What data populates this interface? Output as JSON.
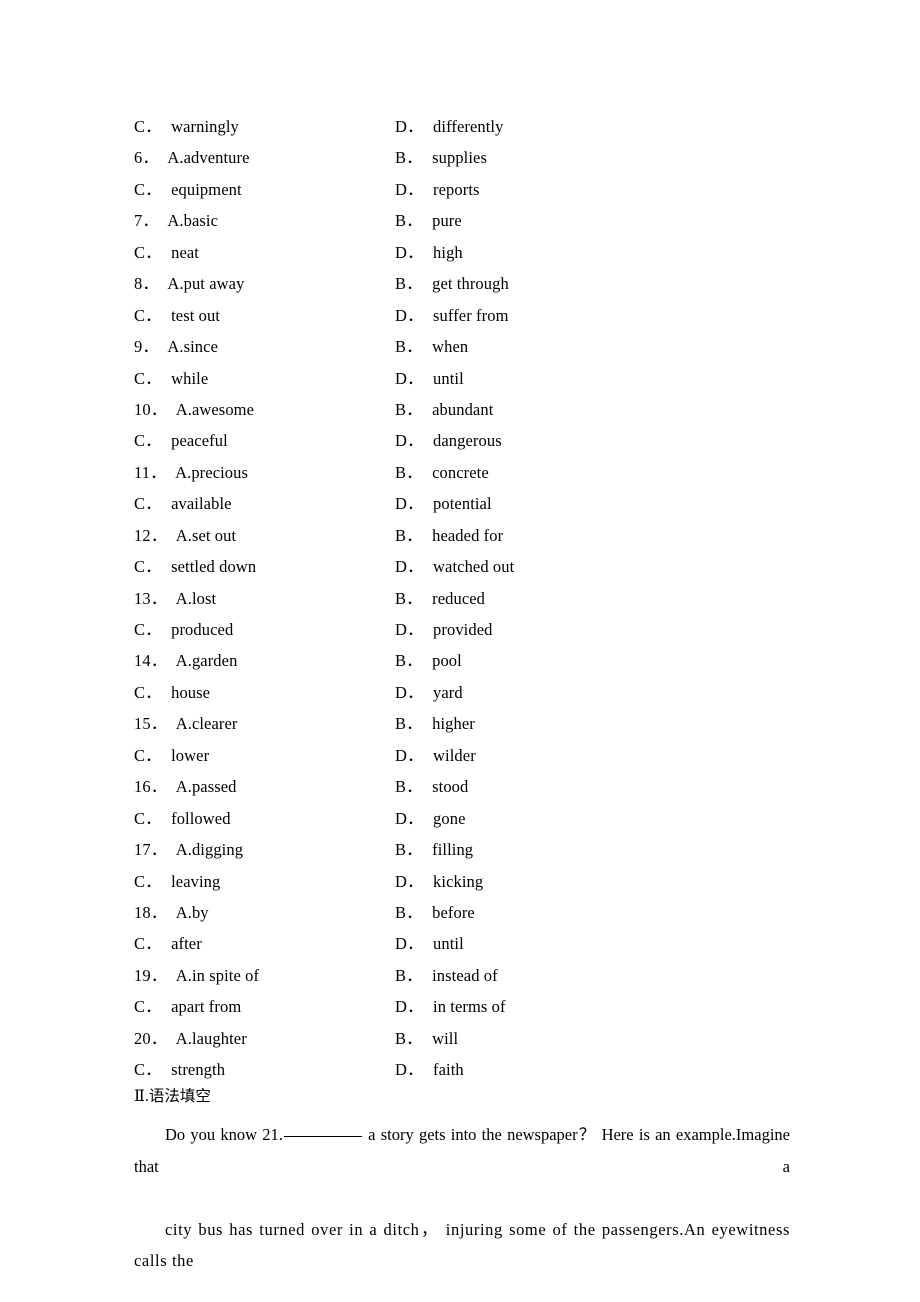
{
  "document": {
    "background_color": "#ffffff",
    "text_color": "#000000"
  },
  "choices": {
    "rows": [
      {
        "left": {
          "kind": "letter",
          "letter": "C",
          "text": "warningly"
        },
        "right": {
          "kind": "letter",
          "letter": "D",
          "text": "differently"
        }
      },
      {
        "left": {
          "kind": "numbered",
          "number": "6",
          "option": "A.adventure"
        },
        "right": {
          "kind": "letter",
          "letter": "B",
          "text": "supplies"
        }
      },
      {
        "left": {
          "kind": "letter",
          "letter": "C",
          "text": "equipment"
        },
        "right": {
          "kind": "letter",
          "letter": "D",
          "text": "reports"
        }
      },
      {
        "left": {
          "kind": "numbered",
          "number": "7",
          "option": "A.basic"
        },
        "right": {
          "kind": "letter",
          "letter": "B",
          "text": "pure"
        }
      },
      {
        "left": {
          "kind": "letter",
          "letter": "C",
          "text": "neat"
        },
        "right": {
          "kind": "letter",
          "letter": "D",
          "text": "high"
        }
      },
      {
        "left": {
          "kind": "numbered",
          "number": "8",
          "option": "A.put away"
        },
        "right": {
          "kind": "letter",
          "letter": "B",
          "text": "get through"
        }
      },
      {
        "left": {
          "kind": "letter",
          "letter": "C",
          "text": "test out"
        },
        "right": {
          "kind": "letter",
          "letter": "D",
          "text": "suffer from"
        }
      },
      {
        "left": {
          "kind": "numbered",
          "number": "9",
          "option": "A.since"
        },
        "right": {
          "kind": "letter",
          "letter": "B",
          "text": "when"
        }
      },
      {
        "left": {
          "kind": "letter",
          "letter": "C",
          "text": "while"
        },
        "right": {
          "kind": "letter",
          "letter": "D",
          "text": "until"
        }
      },
      {
        "left": {
          "kind": "numbered",
          "number": "10",
          "option": "A.awesome"
        },
        "right": {
          "kind": "letter",
          "letter": "B",
          "text": "abundant"
        }
      },
      {
        "left": {
          "kind": "letter",
          "letter": "C",
          "text": "peaceful"
        },
        "right": {
          "kind": "letter",
          "letter": "D",
          "text": "dangerous"
        }
      },
      {
        "left": {
          "kind": "numbered",
          "number": "11",
          "option": "A.precious"
        },
        "right": {
          "kind": "letter",
          "letter": "B",
          "text": "concrete"
        }
      },
      {
        "left": {
          "kind": "letter",
          "letter": "C",
          "text": "available"
        },
        "right": {
          "kind": "letter",
          "letter": "D",
          "text": "potential"
        }
      },
      {
        "left": {
          "kind": "numbered",
          "number": "12",
          "option": "A.set out"
        },
        "right": {
          "kind": "letter",
          "letter": "B",
          "text": "headed for"
        }
      },
      {
        "left": {
          "kind": "letter",
          "letter": "C",
          "text": "settled down"
        },
        "right": {
          "kind": "letter",
          "letter": "D",
          "text": "watched out"
        }
      },
      {
        "left": {
          "kind": "numbered",
          "number": "13",
          "option": "A.lost"
        },
        "right": {
          "kind": "letter",
          "letter": "B",
          "text": "reduced"
        }
      },
      {
        "left": {
          "kind": "letter",
          "letter": "C",
          "text": "produced"
        },
        "right": {
          "kind": "letter",
          "letter": "D",
          "text": "provided"
        }
      },
      {
        "left": {
          "kind": "numbered",
          "number": "14",
          "option": "A.garden"
        },
        "right": {
          "kind": "letter",
          "letter": "B",
          "text": "pool"
        }
      },
      {
        "left": {
          "kind": "letter",
          "letter": "C",
          "text": "house"
        },
        "right": {
          "kind": "letter",
          "letter": "D",
          "text": "yard"
        }
      },
      {
        "left": {
          "kind": "numbered",
          "number": "15",
          "option": "A.clearer"
        },
        "right": {
          "kind": "letter",
          "letter": "B",
          "text": "higher"
        }
      },
      {
        "left": {
          "kind": "letter",
          "letter": "C",
          "text": "lower"
        },
        "right": {
          "kind": "letter",
          "letter": "D",
          "text": "wilder"
        }
      },
      {
        "left": {
          "kind": "numbered",
          "number": "16",
          "option": "A.passed"
        },
        "right": {
          "kind": "letter",
          "letter": "B",
          "text": "stood"
        }
      },
      {
        "left": {
          "kind": "letter",
          "letter": "C",
          "text": "followed"
        },
        "right": {
          "kind": "letter",
          "letter": "D",
          "text": "gone"
        }
      },
      {
        "left": {
          "kind": "numbered",
          "number": "17",
          "option": "A.digging"
        },
        "right": {
          "kind": "letter",
          "letter": "B",
          "text": "filling"
        }
      },
      {
        "left": {
          "kind": "letter",
          "letter": "C",
          "text": "leaving"
        },
        "right": {
          "kind": "letter",
          "letter": "D",
          "text": "kicking"
        }
      },
      {
        "left": {
          "kind": "numbered",
          "number": "18",
          "option": "A.by"
        },
        "right": {
          "kind": "letter",
          "letter": "B",
          "text": "before"
        }
      },
      {
        "left": {
          "kind": "letter",
          "letter": "C",
          "text": "after"
        },
        "right": {
          "kind": "letter",
          "letter": "D",
          "text": "until"
        }
      },
      {
        "left": {
          "kind": "numbered",
          "number": "19",
          "option": "A.in spite of"
        },
        "right": {
          "kind": "letter",
          "letter": "B",
          "text": "instead of"
        }
      },
      {
        "left": {
          "kind": "letter",
          "letter": "C",
          "text": "apart from"
        },
        "right": {
          "kind": "letter",
          "letter": "D",
          "text": "in terms of"
        }
      },
      {
        "left": {
          "kind": "numbered",
          "number": "20",
          "option": "A.laughter"
        },
        "right": {
          "kind": "letter",
          "letter": "B",
          "text": "will"
        }
      },
      {
        "left": {
          "kind": "letter",
          "letter": "C",
          "text": "strength"
        },
        "right": {
          "kind": "letter",
          "letter": "D",
          "text": "faith"
        }
      }
    ],
    "separator": "．"
  },
  "section": {
    "numeral": "Ⅱ",
    "dot": ".",
    "title": "语法填空"
  },
  "passage": {
    "line1_before_blank": "Do you know 21.",
    "blank_number": "21",
    "line1_after_blank": " a story gets into the newspaper？ Here is an example.Imagine that a",
    "line2": "city bus has turned over in a ditch，  injuring some of the passengers.An eyewitness calls the"
  }
}
